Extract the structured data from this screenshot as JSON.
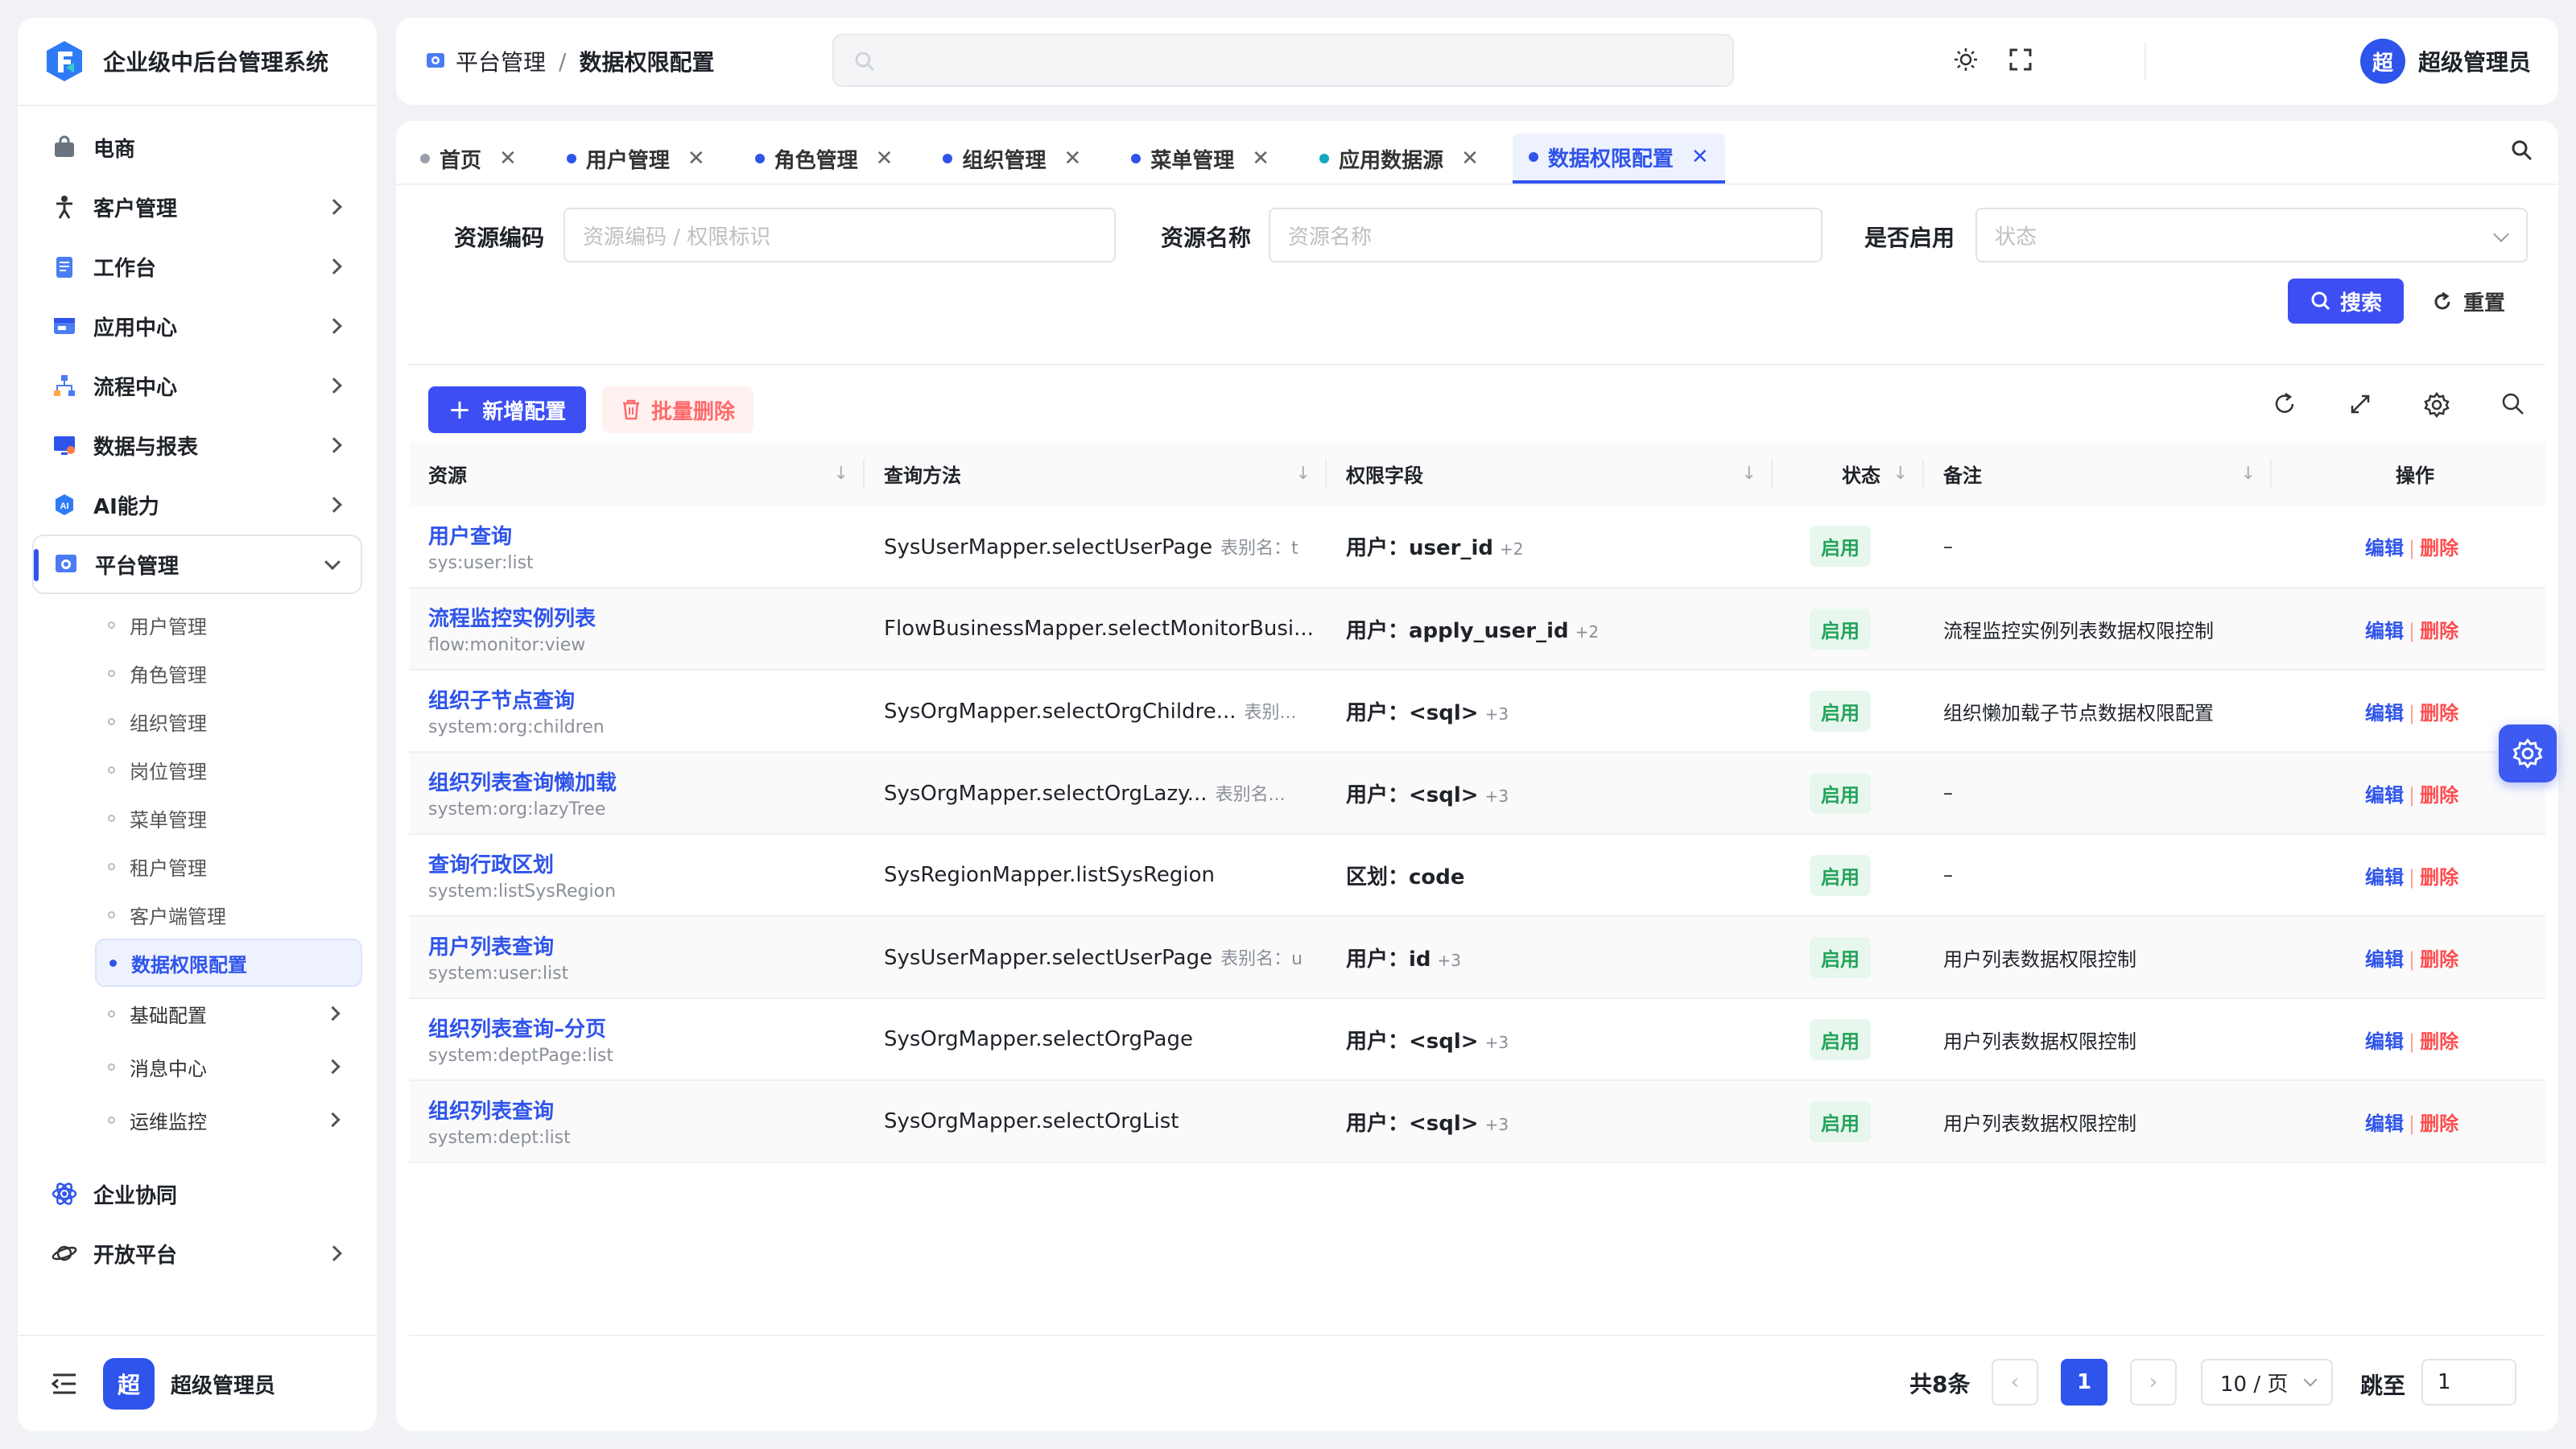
{
  "app": {
    "title": "企业级中后台管理系统"
  },
  "sidebar": {
    "items": [
      {
        "label": "电商",
        "icon": "shopping-bag-icon",
        "has_children": false
      },
      {
        "label": "客户管理",
        "icon": "person-icon",
        "has_children": true
      },
      {
        "label": "工作台",
        "icon": "clipboard-icon",
        "has_children": true
      },
      {
        "label": "应用中心",
        "icon": "app-window-icon",
        "has_children": true
      },
      {
        "label": "流程中心",
        "icon": "flow-icon",
        "has_children": true
      },
      {
        "label": "数据与报表",
        "icon": "report-icon",
        "has_children": true
      },
      {
        "label": "AI能力",
        "icon": "ai-icon",
        "has_children": true
      },
      {
        "label": "平台管理",
        "icon": "platform-gear-icon",
        "has_children": true,
        "expanded": true
      }
    ],
    "platform_children": [
      {
        "label": "用户管理"
      },
      {
        "label": "角色管理"
      },
      {
        "label": "组织管理"
      },
      {
        "label": "岗位管理"
      },
      {
        "label": "菜单管理"
      },
      {
        "label": "租户管理"
      },
      {
        "label": "客户端管理"
      },
      {
        "label": "数据权限配置",
        "active": true
      },
      {
        "label": "基础配置",
        "has_children": true
      },
      {
        "label": "消息中心",
        "has_children": true
      },
      {
        "label": "运维监控",
        "has_children": true
      }
    ],
    "bottom_items": [
      {
        "label": "企业协同",
        "icon": "atom-icon"
      },
      {
        "label": "开放平台",
        "icon": "planet-icon",
        "has_children": true
      }
    ],
    "footer": {
      "avatar": "超",
      "user": "超级管理员"
    }
  },
  "header": {
    "breadcrumb": [
      "平台管理",
      "数据权限配置"
    ],
    "user": {
      "avatar": "超",
      "name": "超级管理员"
    }
  },
  "tabs": [
    {
      "label": "首页",
      "dot": "#9aa0aa"
    },
    {
      "label": "用户管理",
      "dot": "#2f54eb"
    },
    {
      "label": "角色管理",
      "dot": "#2f54eb"
    },
    {
      "label": "组织管理",
      "dot": "#2f54eb"
    },
    {
      "label": "菜单管理",
      "dot": "#2f54eb"
    },
    {
      "label": "应用数据源",
      "dot": "#13a8c2"
    },
    {
      "label": "数据权限配置",
      "dot": "#2f54eb",
      "active": true
    }
  ],
  "filters": {
    "code_label": "资源编码",
    "code_placeholder": "资源编码 / 权限标识",
    "name_label": "资源名称",
    "name_placeholder": "资源名称",
    "enabled_label": "是否启用",
    "enabled_placeholder": "状态",
    "search_button": "搜索",
    "reset_button": "重置"
  },
  "toolbar": {
    "add_button": "新增配置",
    "batch_delete_button": "批量删除"
  },
  "table": {
    "columns": [
      "资源",
      "查询方法",
      "权限字段",
      "状态",
      "备注",
      "操作"
    ],
    "rows": [
      {
        "name": "用户查询",
        "code": "sys:user:list",
        "method": "SysUserMapper.selectUserPage",
        "alias": "表别名：t",
        "perm": "用户：user_id",
        "more": "+2",
        "status": "启用",
        "remark": "–"
      },
      {
        "name": "流程监控实例列表",
        "code": "flow:monitor:view",
        "method": "FlowBusinessMapper.selectMonitorBusi...",
        "alias": "",
        "perm": "用户：apply_user_id",
        "more": "+2",
        "status": "启用",
        "remark": "流程监控实例列表数据权限控制"
      },
      {
        "name": "组织子节点查询",
        "code": "system:org:children",
        "method": "SysOrgMapper.selectOrgChildre...",
        "alias": "表别...",
        "perm": "用户：<sql>",
        "more": "+3",
        "status": "启用",
        "remark": "组织懒加载子节点数据权限配置"
      },
      {
        "name": "组织列表查询懒加载",
        "code": "system:org:lazyTree",
        "method": "SysOrgMapper.selectOrgLazy...",
        "alias": "表别名...",
        "perm": "用户：<sql>",
        "more": "+3",
        "status": "启用",
        "remark": "–"
      },
      {
        "name": "查询行政区划",
        "code": "system:listSysRegion",
        "method": "SysRegionMapper.listSysRegion",
        "alias": "",
        "perm": "区划：code",
        "more": "",
        "status": "启用",
        "remark": "–"
      },
      {
        "name": "用户列表查询",
        "code": "system:user:list",
        "method": "SysUserMapper.selectUserPage",
        "alias": "表别名：u",
        "perm": "用户：id",
        "more": "+3",
        "status": "启用",
        "remark": "用户列表数据权限控制"
      },
      {
        "name": "组织列表查询–分页",
        "code": "system:deptPage:list",
        "method": "SysOrgMapper.selectOrgPage",
        "alias": "",
        "perm": "用户：<sql>",
        "more": "+3",
        "status": "启用",
        "remark": "用户列表数据权限控制"
      },
      {
        "name": "组织列表查询",
        "code": "system:dept:list",
        "method": "SysOrgMapper.selectOrgList",
        "alias": "",
        "perm": "用户：<sql>",
        "more": "+3",
        "status": "启用",
        "remark": "用户列表数据权限控制"
      }
    ],
    "edit_label": "编辑",
    "delete_label": "删除"
  },
  "pagination": {
    "total": "共8条",
    "current": "1",
    "page_size": "10 / 页",
    "jump_label": "跳至",
    "jump_value": "1"
  },
  "colors": {
    "primary": "#2f54eb",
    "success": "#23a35a",
    "danger": "#ff4d4f"
  }
}
